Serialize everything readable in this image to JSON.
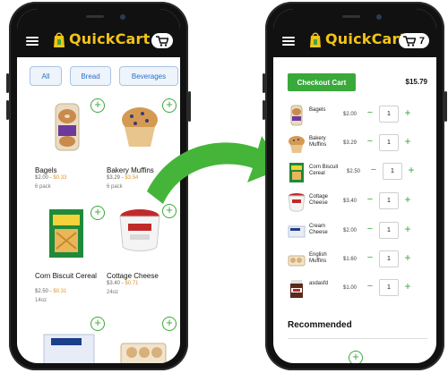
{
  "colors": {
    "brand_yellow": "#f2c318",
    "accent_green": "#39a93a",
    "chip_blue": "#2f6fc0",
    "sale_orange": "#e0962d"
  },
  "left_screen": {
    "app_title": "QuickCart",
    "cart_icon": "shopping-cart-icon",
    "filters": [
      "All",
      "Bread",
      "Beverages"
    ],
    "products": [
      {
        "name": "Bagels",
        "price": "$2.00",
        "sale": "$0.33",
        "size": "6 pack"
      },
      {
        "name": "Bakery Muffins",
        "price": "$3.29",
        "sale": "$3.54",
        "size": "6 pack"
      },
      {
        "name": "Corn Biscuit Cereal",
        "price": "$2.50",
        "sale": "$0.31",
        "size": "14oz"
      },
      {
        "name": "Cottage Cheese",
        "price": "$3.40",
        "sale": "$0.71",
        "size": "24oz"
      }
    ]
  },
  "right_screen": {
    "app_title": "QuickCart",
    "cart_count": "7",
    "checkout_label": "Checkout Cart",
    "total": "$15.79",
    "items": [
      {
        "name": "Bagels",
        "price": "$2.00",
        "qty": "1"
      },
      {
        "name": "Bakery Muffins",
        "price": "$3.29",
        "qty": "1"
      },
      {
        "name": "Corn Biscuit Cereal",
        "price": "$2.50",
        "qty": "1"
      },
      {
        "name": "Cottage Cheese",
        "price": "$3.40",
        "qty": "1"
      },
      {
        "name": "Cream Cheese",
        "price": "$2.00",
        "qty": "1"
      },
      {
        "name": "English Muffins",
        "price": "$1.60",
        "qty": "1"
      },
      {
        "name": "asdasfd",
        "price": "$1.00",
        "qty": "1"
      }
    ],
    "recommended_label": "Recommended"
  }
}
